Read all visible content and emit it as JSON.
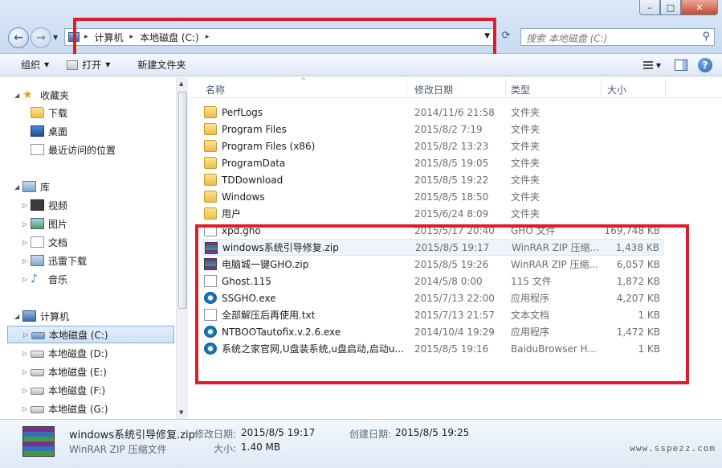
{
  "window": {
    "minimize": "–",
    "maximize": "□",
    "close": "✕"
  },
  "navigation": {
    "back_icon": "←",
    "forward_icon": "→",
    "history_icon": "▼"
  },
  "address": {
    "crumbs": [
      "计算机",
      "本地磁盘 (C:)"
    ],
    "separator": "▸",
    "dropdown_icon": "▼"
  },
  "refresh_icon": "⟳",
  "search": {
    "placeholder": "搜索 本地磁盘 (C:)",
    "icon": "⚲"
  },
  "toolbar": {
    "organize": "组织",
    "open": "打开",
    "new_folder": "新建文件夹",
    "arrow": "▼"
  },
  "sidebar": {
    "favorites": "收藏夹",
    "downloads": "下载",
    "desktop": "桌面",
    "recent": "最近访问的位置",
    "libraries": "库",
    "videos": "视频",
    "pictures": "图片",
    "documents": "文档",
    "thunder": "迅雷下载",
    "music": "音乐",
    "computer": "计算机",
    "drives": [
      "本地磁盘 (C:)",
      "本地磁盘 (D:)",
      "本地磁盘 (E:)",
      "本地磁盘 (F:)",
      "本地磁盘 (G:)"
    ]
  },
  "columns": {
    "name": "名称",
    "modified": "修改日期",
    "type": "类型",
    "size": "大小",
    "sort_indicator": "^"
  },
  "files": [
    {
      "name": "PerfLogs",
      "date": "2014/11/6 21:58",
      "type": "文件夹",
      "size": "",
      "icon": "folder-icon"
    },
    {
      "name": "Program Files",
      "date": "2015/8/2 7:19",
      "type": "文件夹",
      "size": "",
      "icon": "folder-icon"
    },
    {
      "name": "Program Files (x86)",
      "date": "2015/8/2 13:23",
      "type": "文件夹",
      "size": "",
      "icon": "folder-icon"
    },
    {
      "name": "ProgramData",
      "date": "2015/8/5 19:05",
      "type": "文件夹",
      "size": "",
      "icon": "folder-icon"
    },
    {
      "name": "TDDownload",
      "date": "2015/8/5 19:22",
      "type": "文件夹",
      "size": "",
      "icon": "folder-icon"
    },
    {
      "name": "Windows",
      "date": "2015/8/5 18:50",
      "type": "文件夹",
      "size": "",
      "icon": "folder-icon"
    },
    {
      "name": "用户",
      "date": "2015/6/24 8:09",
      "type": "文件夹",
      "size": "",
      "icon": "folder-icon"
    },
    {
      "name": "xpd.gho",
      "date": "2015/5/17 20:40",
      "type": "GHO 文件",
      "size": "169,748 KB",
      "icon": "file-icon"
    },
    {
      "name": "windows系统引导修复.zip",
      "date": "2015/8/5 19:17",
      "type": "WinRAR ZIP 压缩...",
      "size": "1,438 KB",
      "icon": "winrar-icon"
    },
    {
      "name": "电脑城一键GHO.zip",
      "date": "2015/8/5 19:26",
      "type": "WinRAR ZIP 压缩...",
      "size": "6,057 KB",
      "icon": "winrar-icon"
    },
    {
      "name": "Ghost.115",
      "date": "2014/5/8 0:00",
      "type": "115 文件",
      "size": "1,872 KB",
      "icon": "file-icon"
    },
    {
      "name": "SSGHO.exe",
      "date": "2015/7/13 22:00",
      "type": "应用程序",
      "size": "4,207 KB",
      "icon": "app-icon"
    },
    {
      "name": "全部解压后再使用.txt",
      "date": "2015/7/13 21:57",
      "type": "文本文档",
      "size": "1 KB",
      "icon": "text-file-icon"
    },
    {
      "name": "NTBOOTautofix.v.2.6.exe",
      "date": "2014/10/4 19:29",
      "type": "应用程序",
      "size": "1,472 KB",
      "icon": "app-icon"
    },
    {
      "name": "系统之家官网,U盘装系统,u盘启动,启动u...",
      "date": "2015/8/5 19:16",
      "type": "BaiduBrowser H...",
      "size": "1 KB",
      "icon": "browser-icon"
    }
  ],
  "details": {
    "filename": "windows系统引导修复.zip",
    "filetype": "WinRAR ZIP 压缩文件",
    "modified_label": "修改日期:",
    "modified_value": "2015/8/5 19:17",
    "created_label": "创建日期:",
    "created_value": "2015/8/5 19:25",
    "size_label": "大小:",
    "size_value": "1.40 MB"
  },
  "watermark": "www.sspezz.com",
  "colors": {
    "annotation_red": "#e01c2a",
    "selection_blue": "#cfe2f8"
  }
}
